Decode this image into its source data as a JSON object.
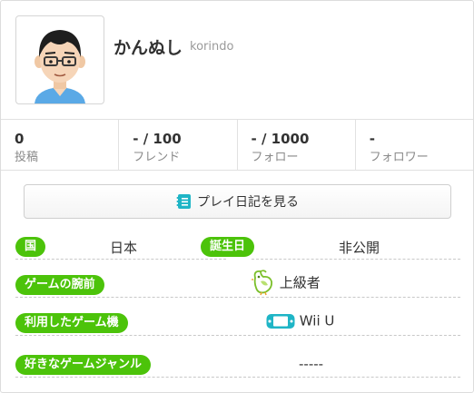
{
  "profile": {
    "screen_name": "かんぬし",
    "user_id": "korindo"
  },
  "stats": [
    {
      "value": "0",
      "label": "投稿"
    },
    {
      "value": "- / 100",
      "label": "フレンド"
    },
    {
      "value": "- / 1000",
      "label": "フォロー"
    },
    {
      "value": "-",
      "label": "フォロワー"
    }
  ],
  "play_journal_button": {
    "label": "プレイ日記を見る",
    "icon": "journal-icon"
  },
  "info": {
    "country_label": "国",
    "country_value": "日本",
    "birthday_label": "誕生日",
    "birthday_value": "非公開",
    "skill_label": "ゲームの腕前",
    "skill_value": "上級者",
    "skill_icon": "bird-icon",
    "system_label": "利用したゲーム機",
    "system_value": "Wii U",
    "system_icon": "wiiu-gamepad-icon",
    "genre_label": "好きなゲームジャンル",
    "genre_value": "-----"
  },
  "colors": {
    "accent_green": "#4cc30a",
    "accent_teal": "#1fb5c6"
  }
}
